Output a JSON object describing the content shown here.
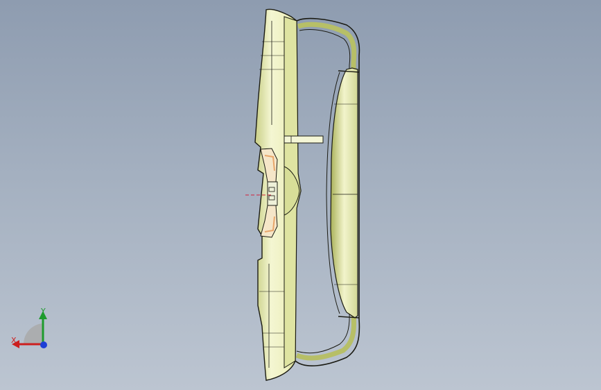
{
  "viewport": {
    "background_top": "#8e9cb0",
    "background_bottom": "#bcc5d1",
    "part_color": "#f0f2c8",
    "part_shadow": "#b7bf67",
    "edge_color": "#1a1a12",
    "section_color": "#e8a66a",
    "center_line_color": "#d0203a"
  },
  "triad": {
    "x_label": "X",
    "y_label": "Y",
    "x_color": "#cc1f1f",
    "y_color": "#1e9b2e",
    "z_color": "#1d3fd6"
  }
}
